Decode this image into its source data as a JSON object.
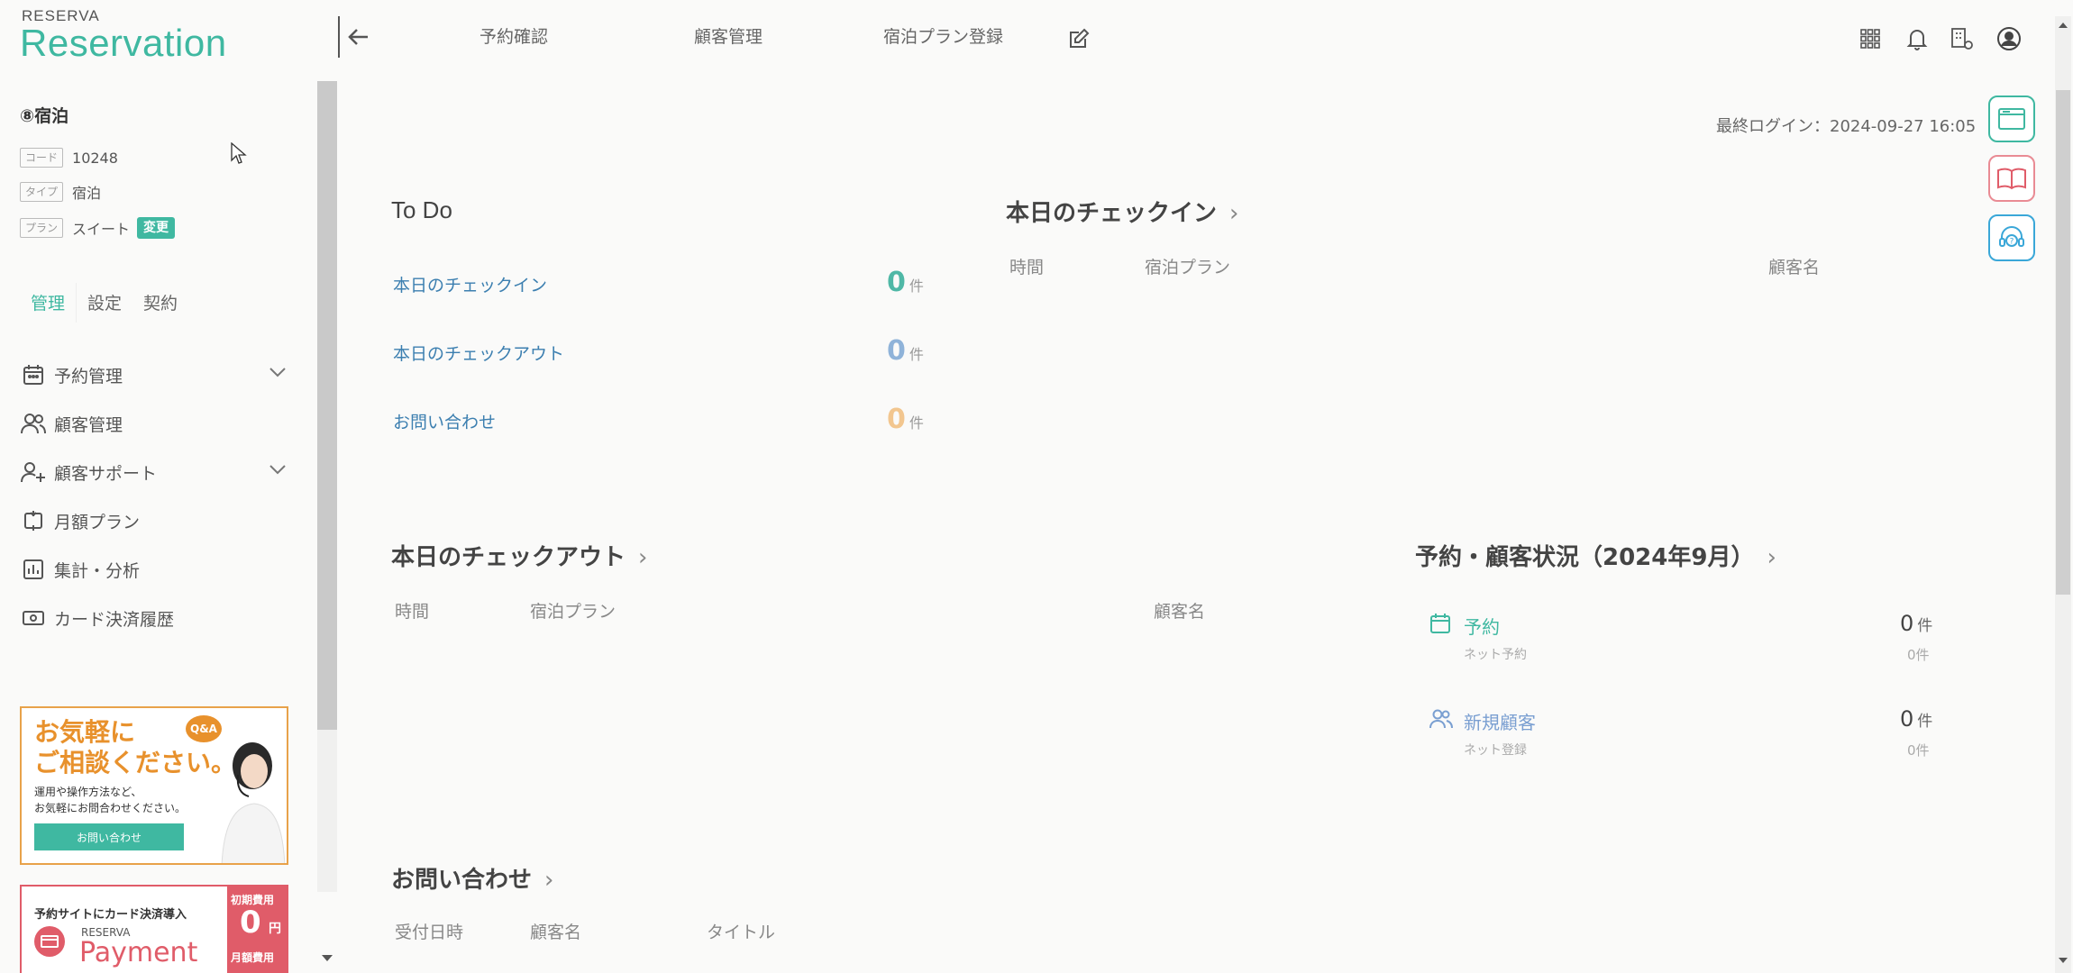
{
  "brand": {
    "small": "RESERVA",
    "big": "Reservation"
  },
  "store": {
    "name": "⑧宿泊",
    "code_tag": "コード",
    "code": "10248",
    "type_tag": "タイプ",
    "type": "宿泊",
    "plan_tag": "プラン",
    "plan": "スイート",
    "change_label": "変更"
  },
  "side_tabs": [
    "管理",
    "設定",
    "契約"
  ],
  "menu": [
    {
      "label": "予約管理",
      "icon": "calendar-icon",
      "expandable": true
    },
    {
      "label": "顧客管理",
      "icon": "users-icon",
      "expandable": false
    },
    {
      "label": "顧客サポート",
      "icon": "user-support-icon",
      "expandable": true
    },
    {
      "label": "月額プラン",
      "icon": "repeat-icon",
      "expandable": false
    },
    {
      "label": "集計・分析",
      "icon": "bar-chart-icon",
      "expandable": false
    },
    {
      "label": "カード決済履歴",
      "icon": "card-icon",
      "expandable": false
    }
  ],
  "banner1": {
    "line1": "お気軽に",
    "line2": "ご相談ください。",
    "qa": "Q&A",
    "body1": "運用や操作方法など、",
    "body2": "お気軽にお問合わせください。",
    "button": "お問い合わせ"
  },
  "banner2": {
    "headline": "予約サイトにカード決済導入",
    "brand_small": "RESERVA",
    "brand_big": "Payment",
    "fee1_label": "初期費用",
    "fee1_value": "0",
    "fee1_unit": "円",
    "fee2_label": "月額費用"
  },
  "header": {
    "nav": [
      "予約確認",
      "顧客管理",
      "宿泊プラン登録"
    ],
    "icons": [
      "apps-grid-icon",
      "bell-icon",
      "building-settings-icon",
      "account-icon"
    ]
  },
  "last_login": "最終ログイン：2024-09-27 16:05",
  "todo": {
    "title": "To Do",
    "items": [
      {
        "label": "本日のチェックイン",
        "count": "0",
        "unit": "件",
        "color": "#4fb8a6"
      },
      {
        "label": "本日のチェックアウト",
        "count": "0",
        "unit": "件",
        "color": "#8fb3d9"
      },
      {
        "label": "お問い合わせ",
        "count": "0",
        "unit": "件",
        "color": "#f2c68f"
      }
    ]
  },
  "checkin": {
    "title": "本日のチェックイン",
    "cols": [
      "時間",
      "宿泊プラン",
      "顧客名"
    ]
  },
  "checkout": {
    "title": "本日のチェックアウト",
    "cols": [
      "時間",
      "宿泊プラン",
      "顧客名"
    ]
  },
  "status": {
    "title": "予約・顧客状況（2024年9月）",
    "rows": [
      {
        "label": "予約",
        "sub": "ネット予約",
        "count": "0",
        "unit": "件",
        "subcount": "0件",
        "icon": "calendar-icon"
      },
      {
        "label": "新規顧客",
        "sub": "ネット登録",
        "count": "0",
        "unit": "件",
        "subcount": "0件",
        "icon": "users-icon"
      }
    ]
  },
  "inquiry": {
    "title": "お問い合わせ",
    "cols": [
      "受付日時",
      "顧客名",
      "タイトル"
    ]
  },
  "colors": {
    "accent": "#3fb8a1",
    "link": "#3c7fb0",
    "banner_orange": "#e8a24a",
    "banner_red": "#e05c69"
  }
}
